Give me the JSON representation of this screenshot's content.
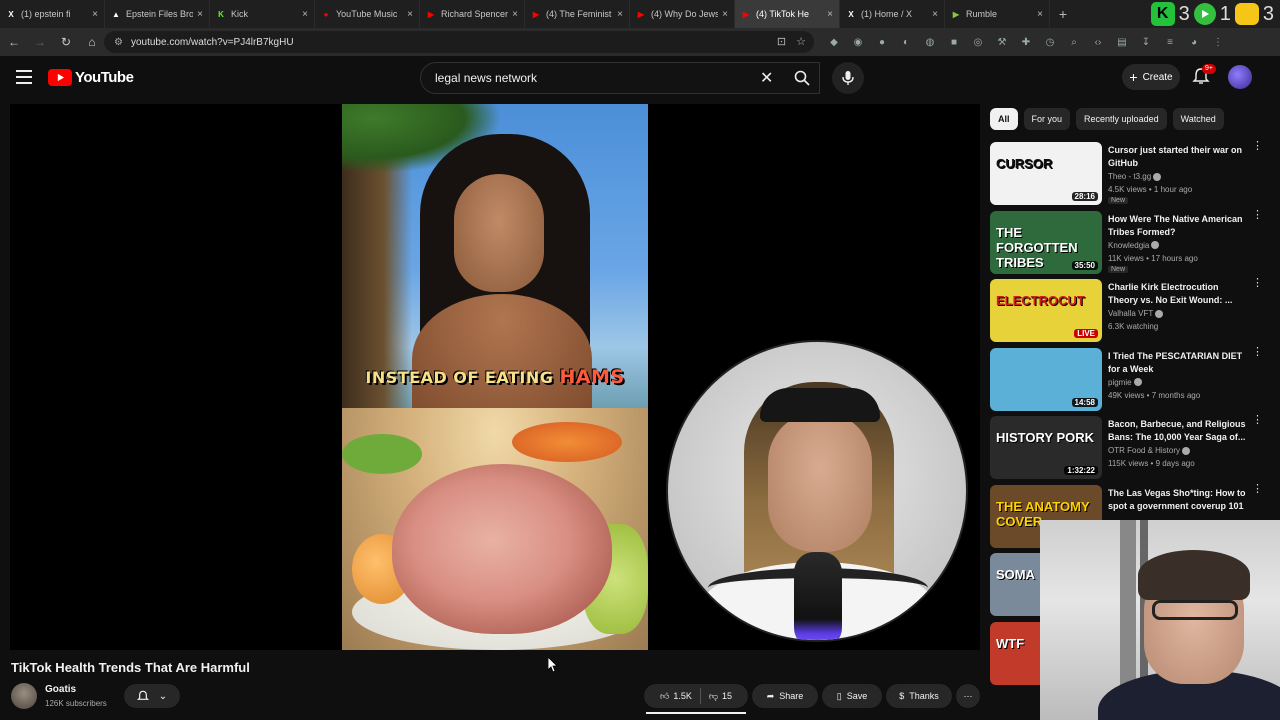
{
  "browser": {
    "tabs": [
      {
        "label": "(1) epstein fi",
        "fav": "X",
        "fav_color": "#ffffff",
        "active": false
      },
      {
        "label": "Epstein Files Bro",
        "fav": "▲",
        "fav_color": "#ffffff",
        "active": false
      },
      {
        "label": "Kick",
        "fav": "K",
        "fav_color": "#53fc18",
        "active": false
      },
      {
        "label": "YouTube Music",
        "fav": "●",
        "fav_color": "#ff0000",
        "active": false
      },
      {
        "label": "Richard Spencer",
        "fav": "▶",
        "fav_color": "#ff0000",
        "active": false
      },
      {
        "label": "(4) The Feminist",
        "fav": "▶",
        "fav_color": "#ff0000",
        "active": false
      },
      {
        "label": "(4) Why Do Jews",
        "fav": "▶",
        "fav_color": "#ff0000",
        "active": false
      },
      {
        "label": "(4) TikTok He",
        "fav": "▶",
        "fav_color": "#ff0000",
        "active": true
      },
      {
        "label": "(1) Home / X",
        "fav": "X",
        "fav_color": "#ffffff",
        "active": false
      },
      {
        "label": "Rumble",
        "fav": "▶",
        "fav_color": "#85c742",
        "active": false
      }
    ],
    "new_tab": "+",
    "tab_close": "×",
    "ext_badge_left": "3",
    "ext_badge_mid": "1",
    "ext_badge_right": "3",
    "url": "youtube.com/watch?v=PJ4lrB7kgHU"
  },
  "youtube": {
    "logo_text": "YouTube",
    "search_value": "legal news network",
    "create_label": "Create",
    "notif_count": "9+",
    "video": {
      "caption_pre": "INSTEAD OF EATING ",
      "caption_hl": "HAMS",
      "title": "TikTok Health Trends That Are Harmful",
      "channel": "Goatis",
      "subscribers": "126K subscribers",
      "likes": "1.5K",
      "dislikes": "15",
      "share_label": "Share",
      "save_label": "Save",
      "thanks_label": "Thanks"
    },
    "chips": [
      "All",
      "For you",
      "Recently uploaded",
      "Watched"
    ],
    "recommendations": [
      {
        "title": "Cursor just started their war on GitHub",
        "channel": "Theo - t3.gg",
        "meta": "4.5K views • 1 hour ago",
        "badge": "New",
        "duration": "28:16",
        "thumb_text": "CURSOR",
        "thumb_bg": "#f2f2f2",
        "thumb_fg": "#111111"
      },
      {
        "title": "How Were The Native American Tribes Formed?",
        "channel": "Knowledgia",
        "meta": "11K views • 17 hours ago",
        "badge": "New",
        "duration": "35:50",
        "thumb_text": "THE FORGOTTEN TRIBES",
        "thumb_bg": "#2f6a3d",
        "thumb_fg": "#ffffff"
      },
      {
        "title": "Charlie Kirk Electrocution Theory vs. No Exit Wound: ...",
        "channel": "Valhalla VFT",
        "meta": "6.3K watching",
        "badge": "",
        "duration": "LIVE",
        "thumb_text": "ELECTROCUT",
        "thumb_bg": "#e8d23a",
        "thumb_fg": "#d11f1f"
      },
      {
        "title": "I Tried The PESCATARIAN DIET for a Week",
        "channel": "pigmie",
        "meta": "49K views • 7 months ago",
        "badge": "",
        "duration": "14:58",
        "thumb_text": "",
        "thumb_bg": "#5bb0d8",
        "thumb_fg": "#ffffff"
      },
      {
        "title": "Bacon, Barbecue, and Religious Bans: The 10,000 Year Saga of...",
        "channel": "OTR Food & History",
        "meta": "115K views • 9 days ago",
        "badge": "",
        "duration": "1:32:22",
        "thumb_text": "HISTORY PORK",
        "thumb_bg": "#2a2a2a",
        "thumb_fg": "#ffffff"
      },
      {
        "title": "The Las Vegas Sho*ting: How to spot a government coverup 101",
        "channel": "",
        "meta": "",
        "badge": "",
        "duration": "",
        "thumb_text": "THE ANATOMY COVER",
        "thumb_bg": "#6b4a2a",
        "thumb_fg": "#ffd200"
      },
      {
        "title": "",
        "channel": "",
        "meta": "",
        "badge": "",
        "duration": "",
        "thumb_text": "SOMA",
        "thumb_bg": "#7a8a9a",
        "thumb_fg": "#ffffff"
      },
      {
        "title": "",
        "channel": "",
        "meta": "",
        "badge": "",
        "duration": "",
        "thumb_text": "WTF",
        "thumb_bg": "#c23a2a",
        "thumb_fg": "#ffffff"
      }
    ]
  },
  "colors": {
    "accent_red": "#ff0000",
    "page_bg": "#0f0f0f",
    "chip_bg": "#272727"
  }
}
